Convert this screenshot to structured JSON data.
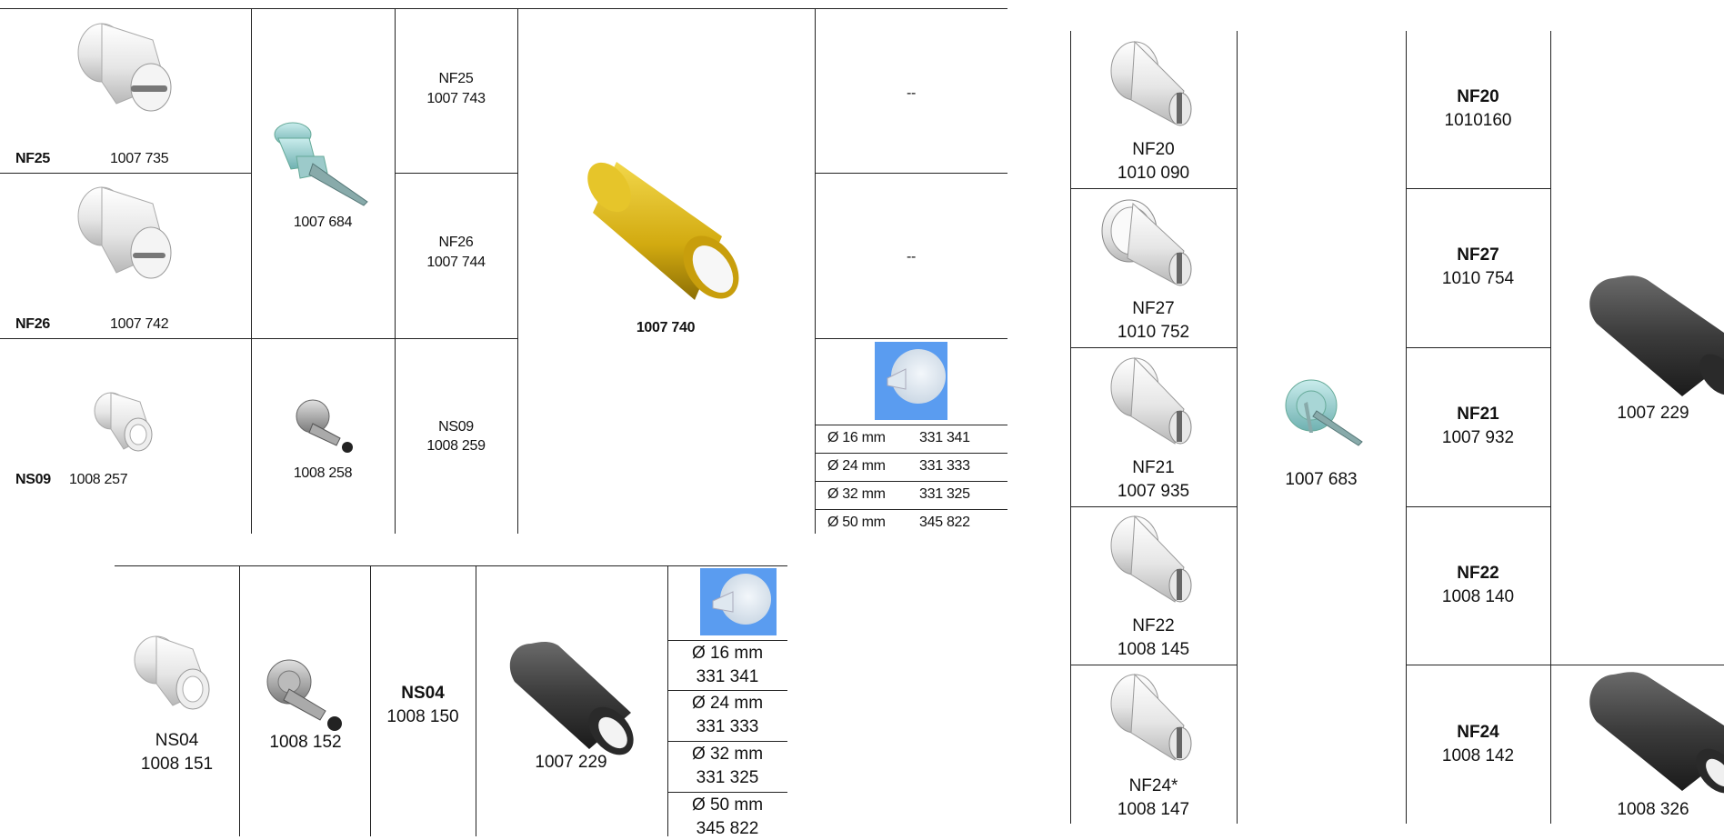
{
  "table_top_left": {
    "rows": [
      {
        "row_name": "NF25",
        "insert_name": "NF25",
        "insert_code": "1007 735",
        "nozzle_code": "1007 684",
        "cap_name": "NF25",
        "cap_code": "1007 743",
        "extra": "--"
      },
      {
        "row_name": "NF26",
        "insert_name": "NF26",
        "insert_code": "1007 742",
        "cap_name": "NF26",
        "cap_code": "1007 744",
        "extra": "--"
      },
      {
        "row_name": "NS09",
        "insert_name": "NS09",
        "insert_code": "1008 257",
        "nozzle_code": "1008 258",
        "cap_name": "NS09",
        "cap_code": "1008 259"
      }
    ],
    "sleeve_code": "1007 740",
    "sizes": [
      {
        "diameter": "Ø 16 mm",
        "code": "331 341"
      },
      {
        "diameter": "Ø 24 mm",
        "code": "331 333"
      },
      {
        "diameter": "Ø 32 mm",
        "code": "331 325"
      },
      {
        "diameter": "Ø 50 mm",
        "code": "345 822"
      }
    ]
  },
  "table_bottom_left": {
    "insert_name": "NS04",
    "insert_code": "1008 151",
    "nozzle_code": "1008 152",
    "cap_name": "NS04",
    "cap_code": "1008 150",
    "sleeve_code": "1007 229",
    "sizes": [
      {
        "diameter": "Ø 16 mm",
        "code": "331 341"
      },
      {
        "diameter": "Ø 24 mm",
        "code": "331 333"
      },
      {
        "diameter": "Ø 32 mm",
        "code": "331 325"
      },
      {
        "diameter": "Ø 50 mm",
        "code": "345 822"
      }
    ]
  },
  "table_right": {
    "rows": [
      {
        "insert_name": "NF20",
        "insert_code": "1010 090",
        "cap_name": "NF20",
        "cap_code": "1010160"
      },
      {
        "insert_name": "NF27",
        "insert_code": "1010 752",
        "cap_name": "NF27",
        "cap_code": "1010 754"
      },
      {
        "insert_name": "NF21",
        "insert_code": "1007 935",
        "cap_name": "NF21",
        "cap_code": "1007 932"
      },
      {
        "insert_name": "NF22",
        "insert_code": "1008 145",
        "cap_name": "NF22",
        "cap_code": "1008 140"
      },
      {
        "insert_name": "NF24*",
        "insert_code": "1008 147",
        "cap_name": "NF24",
        "cap_code": "1008 142"
      }
    ],
    "nozzle_code": "1007 683",
    "sleeve_code_top": "1007 229",
    "sleeve_code_bottom": "1008 326"
  },
  "colors": {
    "line": "#222222",
    "nozzle_teal": "#9fd3d3",
    "sleeve_yellow": "#d9b414",
    "sleeve_dark": "#3a3a3a",
    "cup_bg": "#5a9cf0"
  }
}
